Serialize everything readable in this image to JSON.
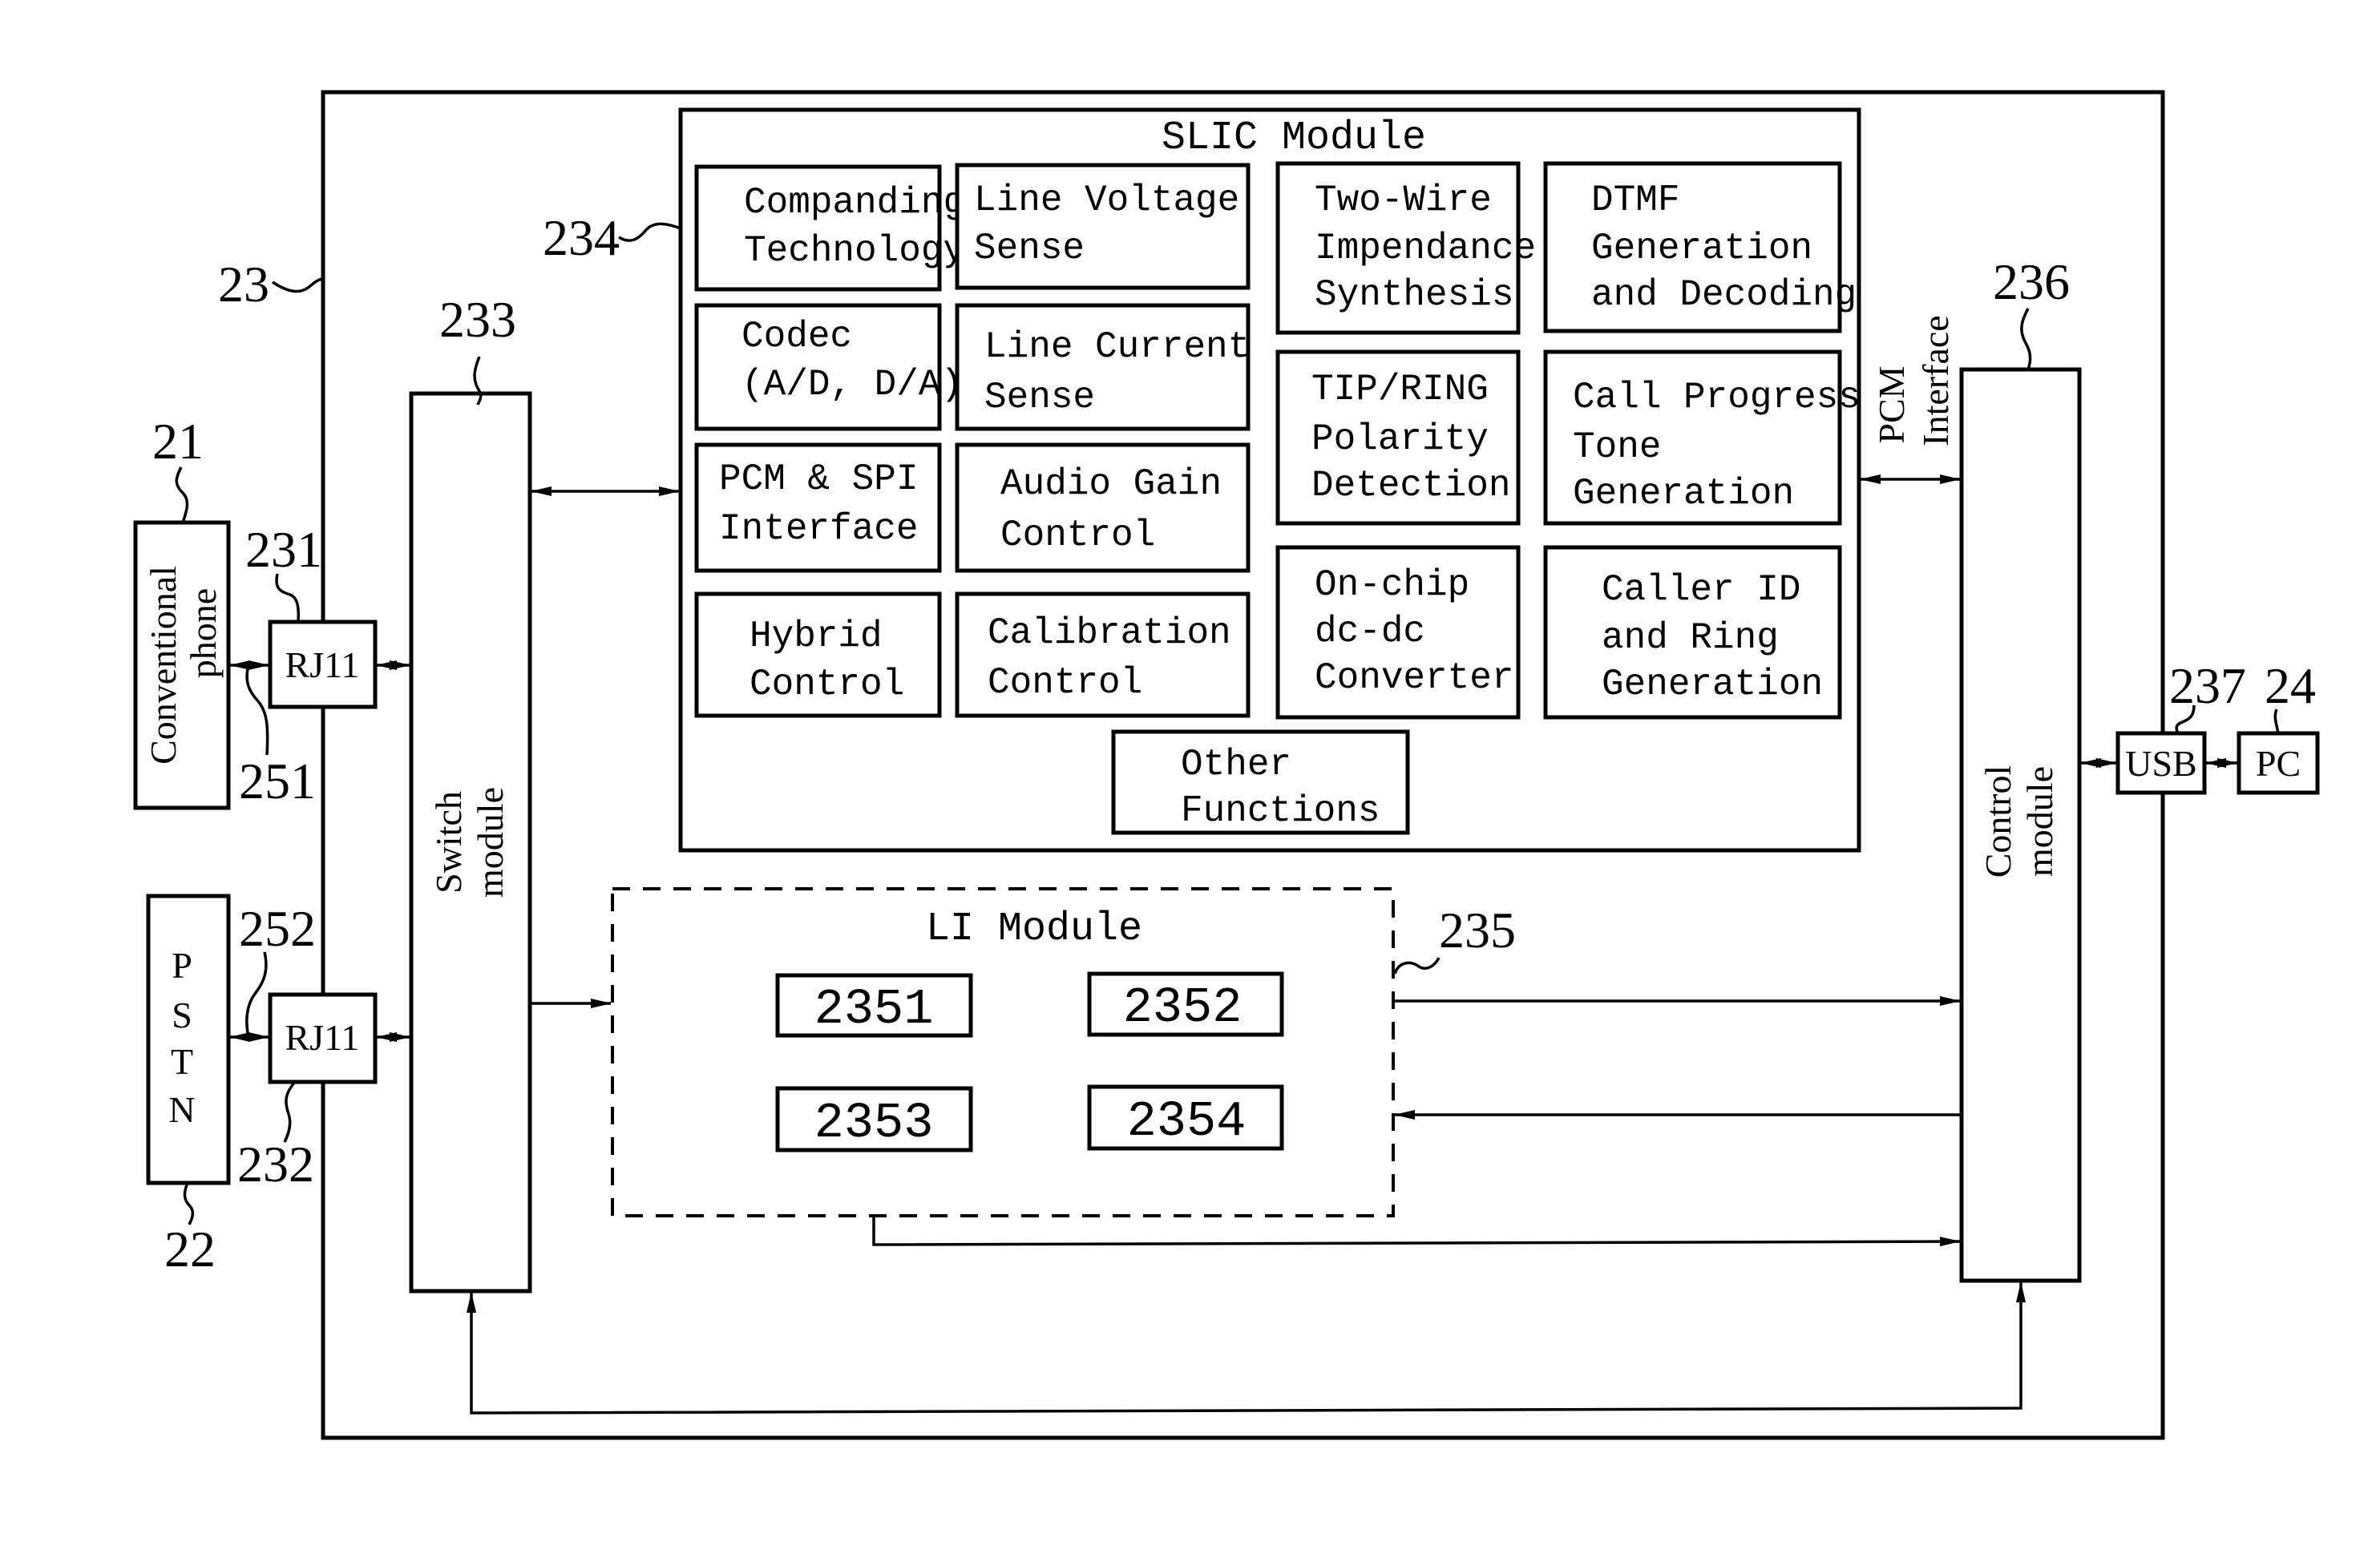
{
  "figure": {
    "device_ref": "23",
    "slic_module": {
      "ref": "234",
      "title": "SLIC Module",
      "functions": [
        {
          "id": "companding",
          "lines": [
            "Companding",
            "Technology"
          ]
        },
        {
          "id": "line-voltage",
          "lines": [
            "Line Voltage",
            "Sense"
          ]
        },
        {
          "id": "two-wire",
          "lines": [
            "Two-Wire",
            "Impendance",
            "Synthesis"
          ]
        },
        {
          "id": "dtmf",
          "lines": [
            "DTMF",
            "Generation",
            "and Decoding"
          ]
        },
        {
          "id": "codec",
          "lines": [
            "Codec",
            "(A/D, D/A)"
          ]
        },
        {
          "id": "line-current",
          "lines": [
            "Line Current",
            "Sense"
          ]
        },
        {
          "id": "tip-ring",
          "lines": [
            "TIP/RING",
            "Polarity",
            "Detection"
          ]
        },
        {
          "id": "call-progress",
          "lines": [
            "Call Progress",
            "Tone",
            "Generation"
          ]
        },
        {
          "id": "pcm-spi",
          "lines": [
            "PCM & SPI",
            "Interface"
          ]
        },
        {
          "id": "audio-gain",
          "lines": [
            "Audio Gain",
            "Control"
          ]
        },
        {
          "id": "dc-dc",
          "lines": [
            "On-chip",
            "dc-dc",
            "Converter"
          ]
        },
        {
          "id": "caller-id",
          "lines": [
            "Caller ID",
            "and Ring",
            "Generation"
          ]
        },
        {
          "id": "hybrid",
          "lines": [
            "Hybrid",
            "Control"
          ]
        },
        {
          "id": "calibration",
          "lines": [
            "Calibration",
            "Control"
          ]
        },
        {
          "id": "other",
          "lines": [
            "Other",
            "Functions"
          ]
        }
      ]
    },
    "li_module": {
      "ref": "235",
      "title": "LI Module",
      "units": [
        "2351",
        "2352",
        "2353",
        "2354"
      ]
    },
    "switch_module": {
      "ref": "233",
      "lines": [
        "Switch",
        "module"
      ]
    },
    "control_module": {
      "ref": "236",
      "lines": [
        "Control",
        "module"
      ]
    },
    "pcm_interface": {
      "lines": [
        "PCM",
        "Interface"
      ]
    },
    "conventional_phone": {
      "ref": "21",
      "lines": [
        "Conventional",
        "phone"
      ]
    },
    "pstn": {
      "ref": "22",
      "letters": [
        "P",
        "S",
        "T",
        "N"
      ]
    },
    "rj11_top": {
      "ref": "231",
      "label": "RJ11"
    },
    "rj11_bottom": {
      "ref": "232",
      "label": "RJ11"
    },
    "line_top": {
      "ref": "251"
    },
    "line_bottom": {
      "ref": "252"
    },
    "usb": {
      "ref": "237",
      "label": "USB"
    },
    "pc": {
      "ref": "24",
      "label": "PC"
    }
  }
}
